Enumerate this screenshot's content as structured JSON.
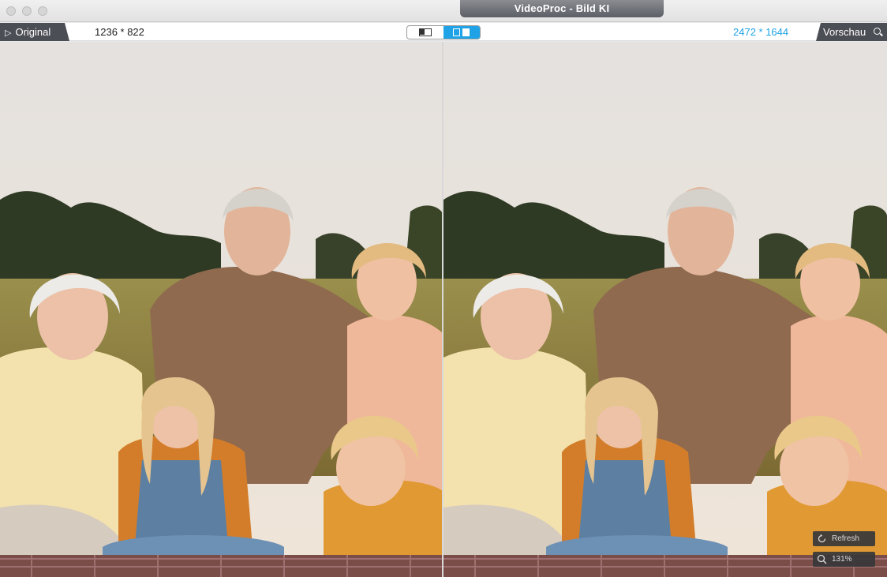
{
  "window": {
    "title": "VideoProc - Bild KI"
  },
  "toolbar": {
    "original_label": "Original",
    "original_resolution": "1236 * 822",
    "upscaled_resolution": "2472 * 1644",
    "preview_label": "Vorschau",
    "view_mode_selected": "split",
    "accent_color": "#1fa3e6"
  },
  "overlay": {
    "refresh_label": "Refresh",
    "zoom_label": "131%"
  },
  "icons": [
    "play-triangle-icon",
    "single-view-icon",
    "split-view-icon",
    "search-icon",
    "refresh-icon",
    "zoom-icon"
  ]
}
